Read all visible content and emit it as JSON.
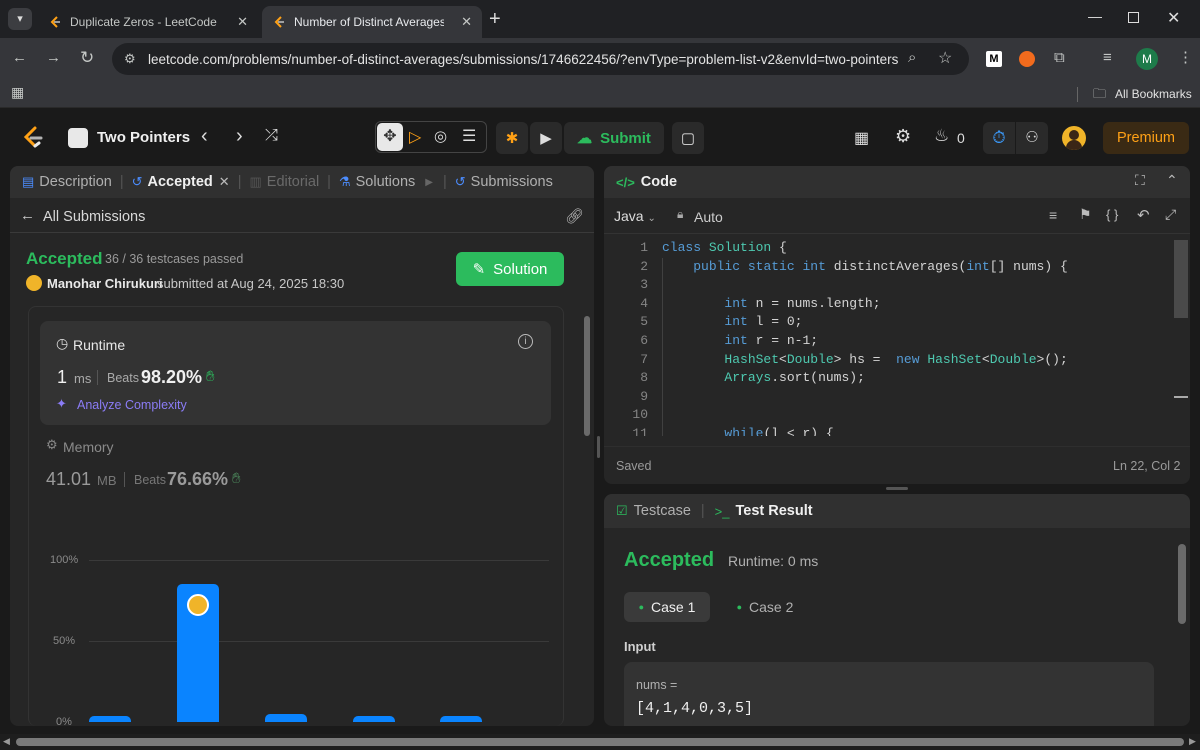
{
  "browser": {
    "tabs": [
      {
        "title": "Duplicate Zeros - LeetCode",
        "active": false
      },
      {
        "title": "Number of Distinct Averages - L",
        "active": true
      }
    ],
    "url": "leetcode.com/problems/number-of-distinct-averages/submissions/1746622456/?envType=problem-list-v2&envId=two-pointers",
    "bookmarks_label": "All Bookmarks",
    "profile_initial": "M",
    "ext_m": "M"
  },
  "navbar": {
    "problem_list": "Two Pointers",
    "submit_label": "Submit",
    "streak": "0",
    "premium_label": "Premium"
  },
  "left_tabs": {
    "description": "Description",
    "accepted": "Accepted",
    "editorial": "Editorial",
    "solutions": "Solutions",
    "submissions": "Submissions"
  },
  "submission": {
    "back_label": "All Submissions",
    "status": "Accepted",
    "testcases": "36 / 36 testcases passed",
    "user": "Manohar Chirukuri",
    "submitted_at": "submitted at Aug 24, 2025 18:30",
    "solution_button": "Solution",
    "runtime_label": "Runtime",
    "runtime_value": "1",
    "runtime_unit": "ms",
    "runtime_beats_label": "Beats",
    "runtime_beats": "98.20%",
    "analyze": "Analyze Complexity",
    "memory_label": "Memory",
    "memory_value": "41.01",
    "memory_unit": "MB",
    "memory_beats_label": "Beats",
    "memory_beats": "76.66%"
  },
  "chart_data": {
    "type": "bar",
    "y_ticks": [
      "100%",
      "50%",
      "0%"
    ],
    "ylim": [
      0,
      100
    ],
    "values": [
      3,
      85,
      5,
      3,
      3
    ],
    "highlight_index": 1
  },
  "code_panel": {
    "title": "Code",
    "language": "Java",
    "mode": "Auto",
    "status": "Saved",
    "cursor": "Ln 22, Col 2",
    "lines": [
      "class Solution {",
      "    public static int distinctAverages(int[] nums) {",
      "",
      "        int n = nums.length;",
      "        int l = 0;",
      "        int r = n-1;",
      "        HashSet<Double> hs =  new HashSet<Double>();",
      "        Arrays.sort(nums);",
      "",
      "",
      "        while(l < r) {"
    ]
  },
  "test_panel": {
    "testcase_tab": "Testcase",
    "result_tab": "Test Result",
    "status": "Accepted",
    "runtime": "Runtime: 0 ms",
    "cases": [
      "Case 1",
      "Case 2"
    ],
    "input_label": "Input",
    "var_name": "nums =",
    "var_value": "[4,1,4,0,3,5]"
  }
}
